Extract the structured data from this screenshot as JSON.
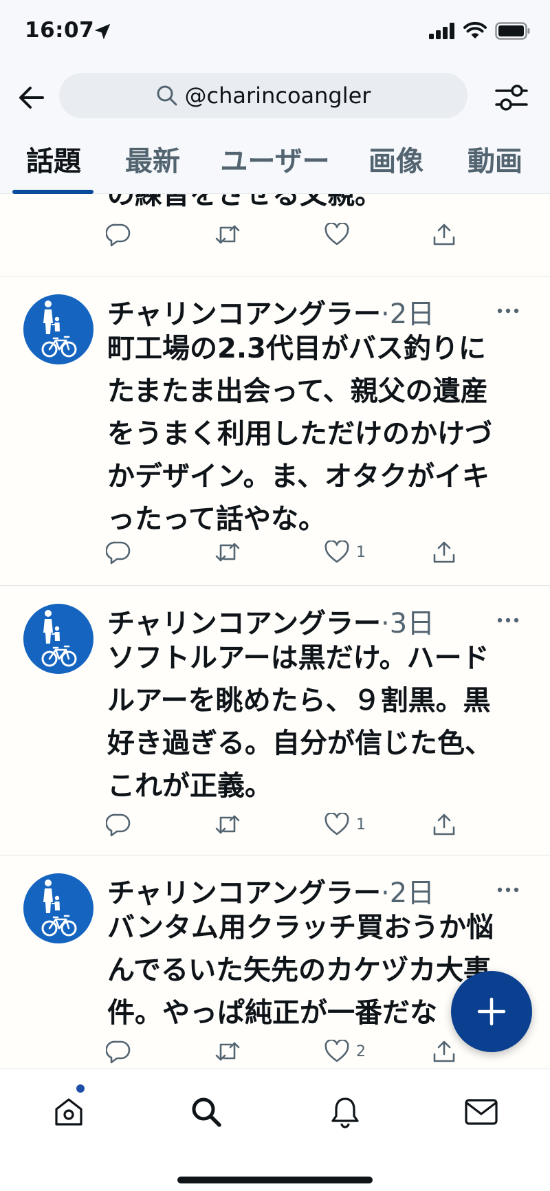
{
  "status_bar": {
    "time": "16:07"
  },
  "search": {
    "query": "@charincoangler"
  },
  "tabs": [
    {
      "label": "話題",
      "active": true
    },
    {
      "label": "最新",
      "active": false
    },
    {
      "label": "ユーザー",
      "active": false
    },
    {
      "label": "画像",
      "active": false
    },
    {
      "label": "動画",
      "active": false
    }
  ],
  "partial_tweet": {
    "text": "の練習をさせる父親。"
  },
  "tweets": [
    {
      "name": "チャリンコアングラー",
      "time": "·2日",
      "body": "町工場の2.3代目がバス釣りに\nたまたま出会って、親父の遺産\nをうまく利用しただけのかけづ\nかデザイン。ま、オタクがイキ\nったって話やな。",
      "likes": "1"
    },
    {
      "name": "チャリンコアングラー",
      "time": "·3日",
      "body": "ソフトルアーは黒だけ。ハード\nルアーを眺めたら、９割黒。黒\n好き過ぎる。自分が信じた色、\nこれが正義。",
      "likes": "1"
    },
    {
      "name": "チャリンコアングラー",
      "time": "·2日",
      "body": "バンタム用クラッチ買おうか悩\nんでるいた矢先のカケヅカ大事\n件。やっぱ純正が一番だな",
      "likes": "2"
    }
  ],
  "colors": {
    "accent": "#0b3f8f",
    "avatar": "#1565c0",
    "muted": "#536471"
  },
  "icons": [
    "location-arrow-icon",
    "signal-icon",
    "wifi-icon",
    "battery-icon",
    "back-arrow-icon",
    "search-icon",
    "filter-icon",
    "reply-icon",
    "retweet-icon",
    "like-icon",
    "share-icon",
    "more-icon",
    "compose-plus-icon",
    "home-icon",
    "search-nav-icon",
    "bell-icon",
    "mail-icon"
  ]
}
